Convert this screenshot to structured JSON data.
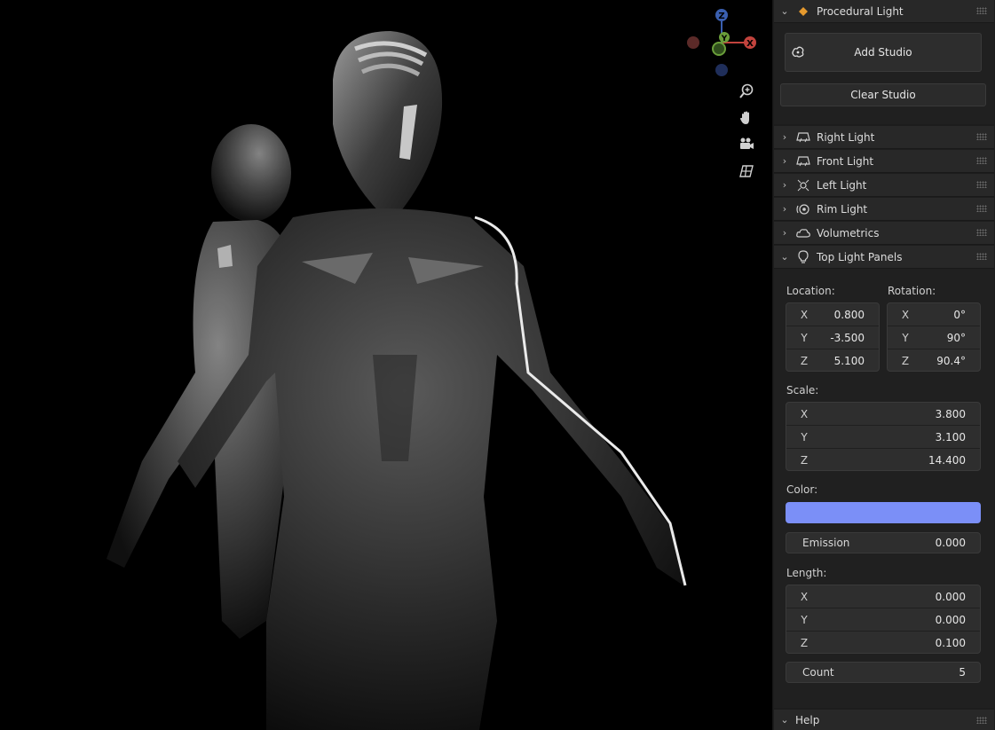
{
  "panel": {
    "procedural_light": {
      "label": "Procedural Light"
    },
    "add_studio": "Add Studio",
    "clear_studio": "Clear Studio",
    "subpanels": [
      {
        "label": "Right Light",
        "icon": "area-light-icon"
      },
      {
        "label": "Front Light",
        "icon": "area-light-icon"
      },
      {
        "label": "Left Light",
        "icon": "spot-light-icon"
      },
      {
        "label": "Rim Light",
        "icon": "rim-light-icon"
      },
      {
        "label": "Volumetrics",
        "icon": "cloud-icon"
      },
      {
        "label": "Top Light Panels",
        "icon": "light-bulb-icon"
      }
    ],
    "location": {
      "label": "Location:",
      "x_label": "X",
      "x": "0.800",
      "y_label": "Y",
      "y": "-3.500",
      "z_label": "Z",
      "z": "5.100"
    },
    "rotation": {
      "label": "Rotation:",
      "x_label": "X",
      "x": "0°",
      "y_label": "Y",
      "y": "90°",
      "z_label": "Z",
      "z": "90.4°"
    },
    "scale": {
      "label": "Scale:",
      "x_label": "X",
      "x": "3.800",
      "y_label": "Y",
      "y": "3.100",
      "z_label": "Z",
      "z": "14.400"
    },
    "color": {
      "label": "Color:",
      "value": "#7b8ff7"
    },
    "emission": {
      "label": "Emission",
      "value": "0.000"
    },
    "length": {
      "label": "Length:",
      "x_label": "X",
      "x": "0.000",
      "y_label": "Y",
      "y": "0.000",
      "z_label": "Z",
      "z": "0.100"
    },
    "count": {
      "label": "Count",
      "value": "5"
    },
    "help": {
      "label": "Help"
    }
  },
  "gizmo": {
    "z": "Z",
    "y": "Y",
    "x": "X"
  },
  "colors": {
    "accent_orange": "#e69a2e",
    "axis_x": "#c2433d",
    "axis_y": "#6a9e3a",
    "axis_z": "#3a5fb0"
  }
}
